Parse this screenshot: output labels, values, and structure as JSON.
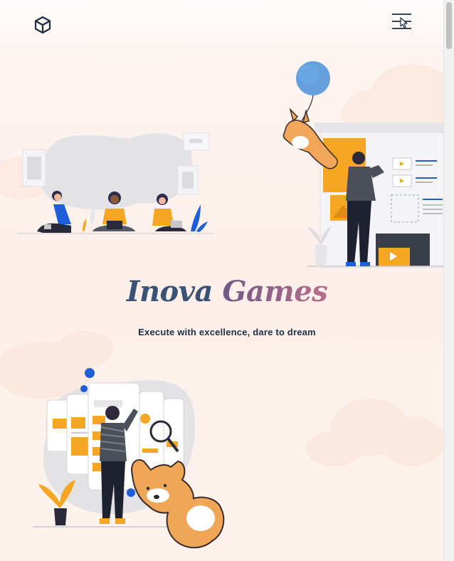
{
  "brand": {
    "logo_icon": "cube-icon"
  },
  "nav": {
    "menu_icon": "hamburger-menu-icon"
  },
  "hero": {
    "title_part1": "Inova",
    "title_part2": "Games",
    "tagline": "Execute with excellence, dare to dream"
  },
  "colors": {
    "navy": "#1c2d45",
    "title_blue": "#3a5276",
    "title_pink": "#b66d88",
    "orange": "#f29a1a",
    "accent_blue": "#1565d8"
  }
}
